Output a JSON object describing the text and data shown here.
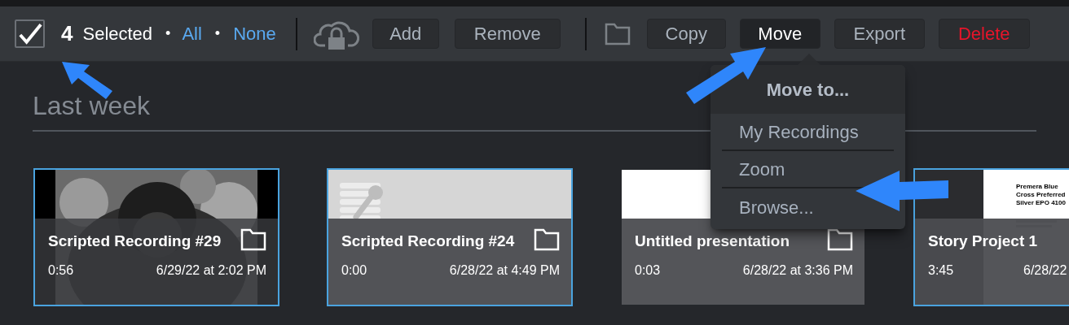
{
  "toolbar": {
    "select_all_checked": true,
    "count": "4",
    "selected_label": "Selected",
    "separator_1": "•",
    "all_link": "All",
    "separator_2": "•",
    "none_link": "None",
    "cloud_buttons": [
      {
        "label": "Add"
      },
      {
        "label": "Remove"
      }
    ],
    "folder_buttons": [
      {
        "label": "Copy",
        "kind": "normal",
        "selected": false
      },
      {
        "label": "Move",
        "kind": "normal",
        "selected": true
      },
      {
        "label": "Export",
        "kind": "normal",
        "selected": false
      },
      {
        "label": "Delete",
        "kind": "danger",
        "selected": false
      }
    ]
  },
  "section": {
    "title": "Last week"
  },
  "recordings": [
    {
      "title": "Scripted Recording #29",
      "duration": "0:56",
      "date": "6/29/22 at 2:02 PM",
      "selected": true,
      "kind": "picture"
    },
    {
      "title": "Scripted Recording #24",
      "duration": "0:00",
      "date": "6/28/22 at 4:49 PM",
      "selected": true,
      "kind": "script"
    },
    {
      "title": "Untitled presentation",
      "duration": "0:03",
      "date": "6/28/22 at 3:36 PM",
      "selected": false,
      "kind": "blank"
    },
    {
      "title": "Story Project 1",
      "duration": "3:45",
      "date": "6/28/22",
      "selected": true,
      "kind": "document",
      "doc_title": "Premera Blue Cross Preferred Silver EPO 4100"
    }
  ],
  "move_menu": {
    "title": "Move to...",
    "items": [
      "My Recordings",
      "Zoom",
      "Browse..."
    ]
  }
}
